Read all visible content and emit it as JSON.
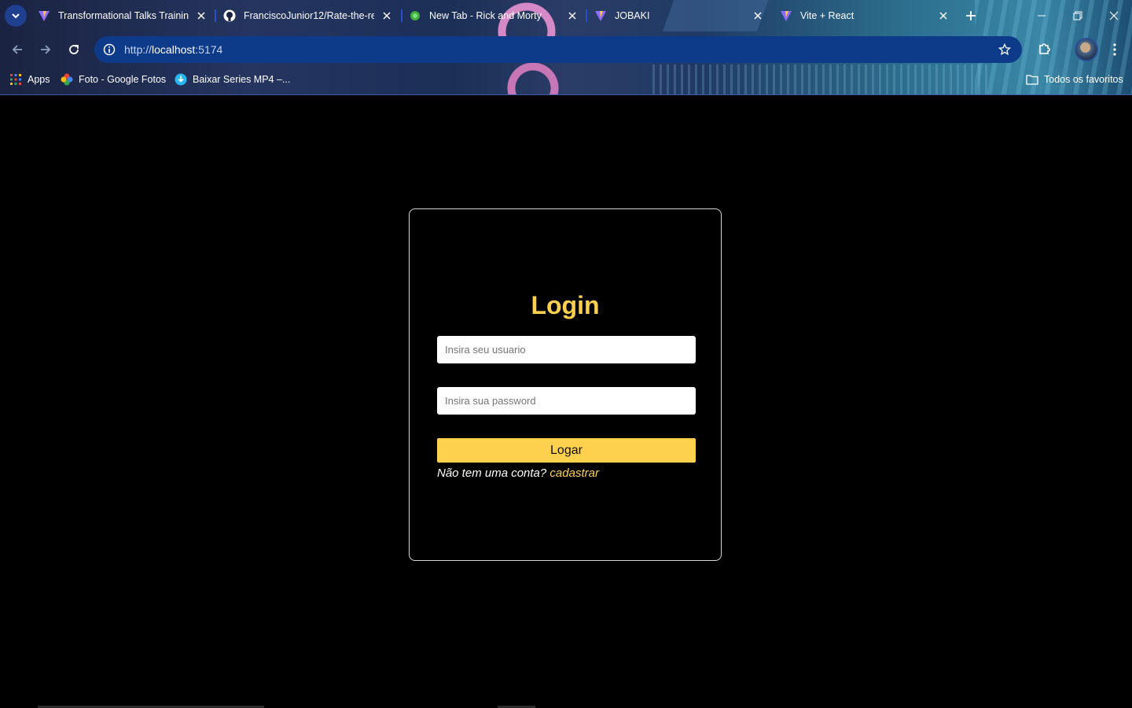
{
  "browser": {
    "tabs": [
      {
        "title": "Transformational Talks Training",
        "favicon": "vite-icon",
        "active": false
      },
      {
        "title": "FranciscoJunior12/Rate-the-res",
        "favicon": "github-icon",
        "active": false
      },
      {
        "title": "New Tab - Rick and Morty",
        "favicon": "green-circle-icon",
        "active": false
      },
      {
        "title": "JOBAKI",
        "favicon": "vite-icon",
        "active": false
      },
      {
        "title": "Vite + React",
        "favicon": "vite-icon",
        "active": true
      }
    ],
    "url_scheme": "http://",
    "url_host": "localhost",
    "url_port": ":5174",
    "bookmarks": [
      {
        "label": "Apps",
        "icon": "apps-grid-icon"
      },
      {
        "label": "Foto - Google Fotos",
        "icon": "google-photos-icon"
      },
      {
        "label": "Baixar Series MP4 –...",
        "icon": "download-icon"
      }
    ],
    "other_bookmarks": "Todos os favoritos"
  },
  "login": {
    "title": "Login",
    "username_placeholder": "Insira seu usuario",
    "password_placeholder": "Insira sua password",
    "submit_label": "Logar",
    "signup_prompt": "Não tem uma conta?",
    "signup_link": "cadastrar"
  },
  "colors": {
    "accent": "#fdd14e",
    "background": "#000000",
    "omnibox": "#0e3a8a"
  }
}
